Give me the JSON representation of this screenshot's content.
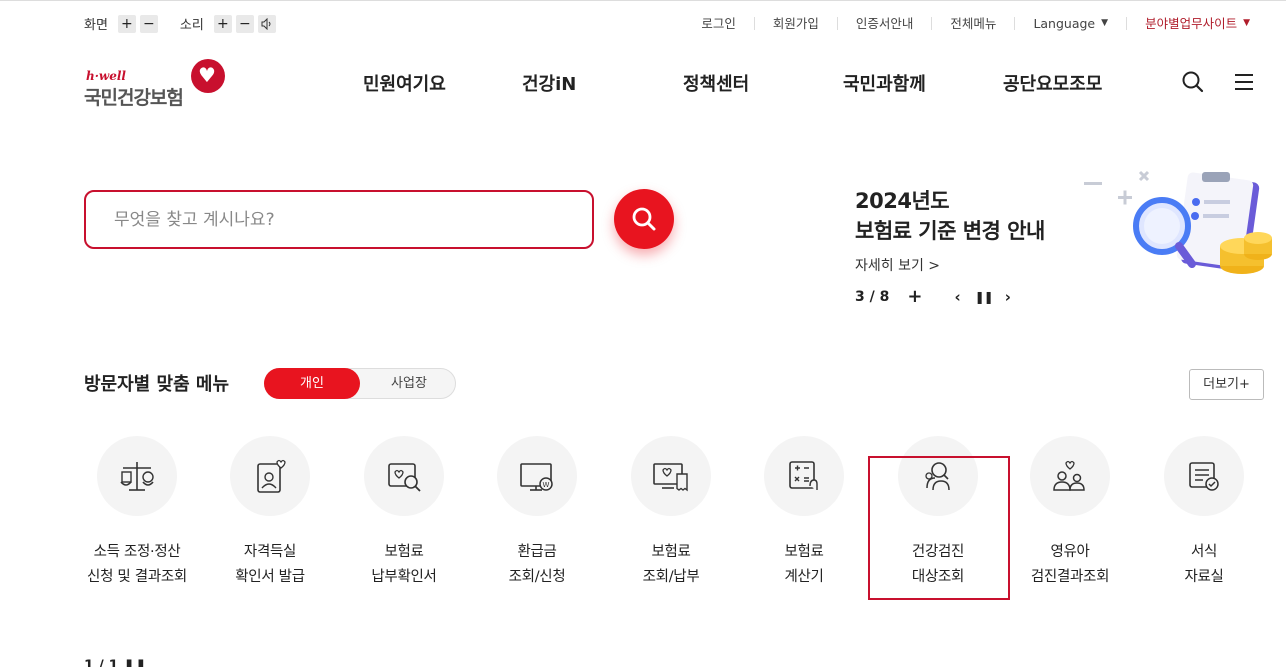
{
  "utility": {
    "screen_label": "화면",
    "sound_label": "소리",
    "plus": "+",
    "minus": "−",
    "speaker": "🔈",
    "links": [
      "로그인",
      "회원가입",
      "인증서안내",
      "전체메뉴"
    ],
    "language": "Language",
    "business_site": "분야별업무사이트"
  },
  "header": {
    "logo_top": "h·well",
    "logo_name": "국민건강보험",
    "menu": [
      "민원여기요",
      "건강iN",
      "정책센터",
      "국민과함께",
      "공단요모조모"
    ]
  },
  "search": {
    "placeholder": "무엇을 찾고 계시나요?"
  },
  "promo": {
    "title_line1": "2024년도",
    "title_line2": "보험료 기준 변경 안내",
    "more": "자세히 보기 >",
    "page": "3 / 8",
    "plus": "+",
    "prev": "‹",
    "pause": "❚❚",
    "next": "›"
  },
  "quick": {
    "title": "방문자별 맞춤 메뉴",
    "tab_personal": "개인",
    "tab_business": "사업장",
    "more": "더보기+",
    "items": [
      {
        "line1": "소득 조정·정산",
        "line2": "신청 및 결과조회",
        "icon": "scale-won-icon"
      },
      {
        "line1": "자격득실",
        "line2": "확인서 발급",
        "icon": "id-card-heart-icon"
      },
      {
        "line1": "보험료",
        "line2": "납부확인서",
        "icon": "heart-search-icon"
      },
      {
        "line1": "환급금",
        "line2": "조회/신청",
        "icon": "monitor-won-icon"
      },
      {
        "line1": "보험료",
        "line2": "조회/납부",
        "icon": "screen-receipt-icon"
      },
      {
        "line1": "보험료",
        "line2": "계산기",
        "icon": "calculator-icon"
      },
      {
        "line1": "건강검진",
        "line2": "대상조회",
        "icon": "people-search-icon"
      },
      {
        "line1": "영유아",
        "line2": "검진결과조회",
        "icon": "family-heart-icon"
      },
      {
        "line1": "서식",
        "line2": "자료실",
        "icon": "document-check-icon"
      }
    ]
  },
  "footer_fragment": "1 / 1 ❚❚"
}
